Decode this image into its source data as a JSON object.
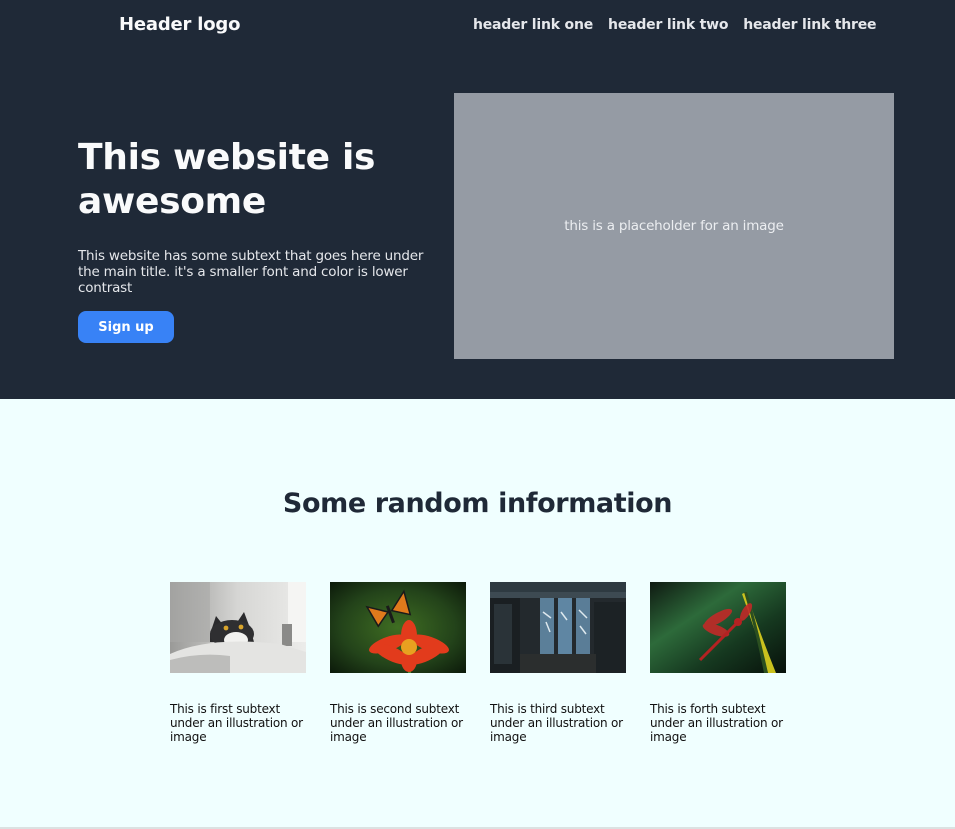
{
  "header": {
    "logo": "Header logo",
    "links": [
      "header link one",
      "header link two",
      "header link three"
    ]
  },
  "hero": {
    "title": "This website is awesome",
    "subtext": "This website has some subtext that goes here under the main title. it's a smaller font and color is lower contrast",
    "cta_label": "Sign up",
    "image_placeholder": "this is a placeholder for an image"
  },
  "info": {
    "title": "Some random information",
    "cards": [
      {
        "image": "cat-photo",
        "text": "This is first subtext under an illustration or image"
      },
      {
        "image": "butterfly-photo",
        "text": "This is second subtext under an illustration or image"
      },
      {
        "image": "japanese-street-photo",
        "text": "This is third subtext under an illustration or image"
      },
      {
        "image": "dragonfly-photo",
        "text": "This is forth subtext under an illustration or image"
      }
    ]
  },
  "colors": {
    "dark_bg": "#1f2937",
    "light_bg": "#f0ffff",
    "accent": "#3882f6",
    "placeholder": "#959ba4"
  }
}
